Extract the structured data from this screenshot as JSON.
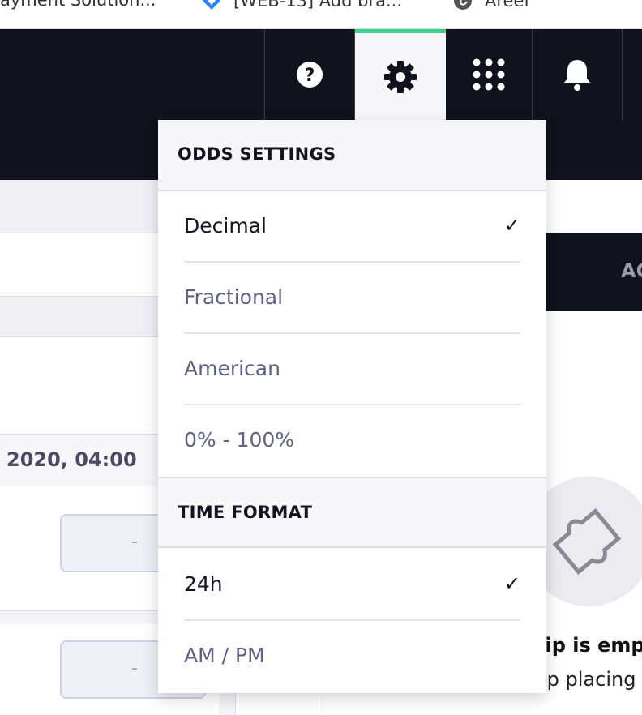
{
  "bookmarks": [
    {
      "label": "ayment Solution..."
    },
    {
      "label": "[WEB-13] Add bra..."
    },
    {
      "label": "Areef"
    }
  ],
  "topnav": {
    "help_icon": "question-circle-icon",
    "settings_icon": "gear-icon",
    "apps_icon": "grid-dots-icon",
    "notifications_icon": "bell-icon",
    "accent_color": "#3fcf8e"
  },
  "content": {
    "date_text": "2020, 04:00",
    "odds_placeholder_1": "-",
    "odds_placeholder_2": "-"
  },
  "betslip": {
    "tab_label": "AC",
    "empty_title": "slip is emp",
    "empty_sub": "lp placing",
    "empty_icon": "ticket-icon"
  },
  "dropdown": {
    "odds_heading": "ODDS SETTINGS",
    "odds_options": [
      {
        "label": "Decimal",
        "selected": true
      },
      {
        "label": "Fractional",
        "selected": false
      },
      {
        "label": "American",
        "selected": false
      },
      {
        "label": "0% - 100%",
        "selected": false
      }
    ],
    "time_heading": "TIME FORMAT",
    "time_options": [
      {
        "label": "24h",
        "selected": true
      },
      {
        "label": "AM / PM",
        "selected": false
      }
    ],
    "check_mark": "✓"
  }
}
